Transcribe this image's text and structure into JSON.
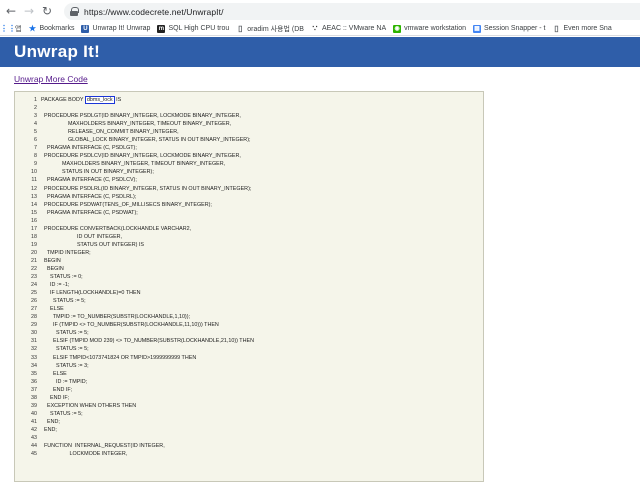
{
  "browser": {
    "back_icon": "back-arrow-icon",
    "forward_icon": "forward-arrow-icon",
    "reload_icon": "reload-icon",
    "url": "https://www.codecrete.net/UnwrapIt/"
  },
  "bookmarks": [
    {
      "label": "앱",
      "icon": "apps-grid-icon",
      "color": "#1a73e8"
    },
    {
      "label": "Bookmarks",
      "icon": "star-icon",
      "color": "#1a73e8"
    },
    {
      "label": "Unwrap It! Unwrap",
      "icon": "u-site-icon",
      "color": "#2f5ea9"
    },
    {
      "label": "SQL High CPU trou",
      "icon": "m-site-icon",
      "color": "#222222"
    },
    {
      "label": "oradim 사용법 (DB",
      "icon": "page-icon",
      "color": "#5f6368"
    },
    {
      "label": "AEAC :: VMware NA",
      "icon": "dots-icon",
      "color": "#333333"
    },
    {
      "label": "vmware workstation",
      "icon": "chat-icon",
      "color": "#2db400"
    },
    {
      "label": "Session Snapper - t",
      "icon": "calendar-icon",
      "color": "#4285f4"
    },
    {
      "label": "Even more Sna",
      "icon": "page-icon",
      "color": "#5f6368"
    }
  ],
  "page": {
    "title": "Unwrap It!",
    "more_link": "Unwrap More Code"
  },
  "code": {
    "highlight_token": "dbms_lock",
    "lines": [
      {
        "n": "1",
        "pre": "PACKAGE BODY ",
        "hl": "dbms_lock",
        "post": " IS"
      },
      {
        "n": "2",
        "text": ""
      },
      {
        "n": "3",
        "text": "  PROCEDURE PSDLGT(ID BINARY_INTEGER, LOCKMODE BINARY_INTEGER,"
      },
      {
        "n": "4",
        "text": "                  MAXHOLDERS BINARY_INTEGER, TIMEOUT BINARY_INTEGER,"
      },
      {
        "n": "5",
        "text": "                  RELEASE_ON_COMMIT BINARY_INTEGER,"
      },
      {
        "n": "6",
        "text": "                  GLOBAL_LOCK BINARY_INTEGER, STATUS IN OUT BINARY_INTEGER);"
      },
      {
        "n": "7",
        "text": "    PRAGMA INTERFACE (C, PSDLGT);"
      },
      {
        "n": "8",
        "text": "  PROCEDURE PSDLCV(ID BINARY_INTEGER, LOCKMODE BINARY_INTEGER,"
      },
      {
        "n": "9",
        "text": "              MAXHOLDERS BINARY_INTEGER, TIMEOUT BINARY_INTEGER,"
      },
      {
        "n": "10",
        "text": "              STATUS IN OUT BINARY_INTEGER);"
      },
      {
        "n": "11",
        "text": "    PRAGMA INTERFACE (C, PSDLCV);"
      },
      {
        "n": "12",
        "text": "  PROCEDURE PSDLRL(ID BINARY_INTEGER, STATUS IN OUT BINARY_INTEGER);"
      },
      {
        "n": "13",
        "text": "    PRAGMA INTERFACE (C, PSDLRL);"
      },
      {
        "n": "14",
        "text": "  PROCEDURE PSDWAT(TENS_OF_MILLISECS BINARY_INTEGER);"
      },
      {
        "n": "15",
        "text": "    PRAGMA INTERFACE (C, PSDWAT);"
      },
      {
        "n": "16",
        "text": ""
      },
      {
        "n": "17",
        "text": "  PROCEDURE CONVERTBACK(LOCKHANDLE VARCHAR2,"
      },
      {
        "n": "18",
        "text": "                        ID OUT INTEGER,"
      },
      {
        "n": "19",
        "text": "                        STATUS OUT INTEGER) IS"
      },
      {
        "n": "20",
        "text": "    TMPID INTEGER;"
      },
      {
        "n": "21",
        "text": "  BEGIN"
      },
      {
        "n": "22",
        "text": "    BEGIN"
      },
      {
        "n": "23",
        "text": "      STATUS := 0;"
      },
      {
        "n": "24",
        "text": "      ID := -1;"
      },
      {
        "n": "25",
        "text": "      IF LENGTH(LOCKHANDLE)=0 THEN"
      },
      {
        "n": "26",
        "text": "        STATUS := 5;"
      },
      {
        "n": "27",
        "text": "      ELSE"
      },
      {
        "n": "28",
        "text": "        TMPID := TO_NUMBER(SUBSTR(LOCKHANDLE,1,10));"
      },
      {
        "n": "29",
        "text": "        IF (TMPID <> TO_NUMBER(SUBSTR(LOCKHANDLE,11,10))) THEN"
      },
      {
        "n": "30",
        "text": "          STATUS := 5;"
      },
      {
        "n": "31",
        "text": "        ELSIF (TMPID MOD 239) <> TO_NUMBER(SUBSTR(LOCKHANDLE,21,10)) THEN"
      },
      {
        "n": "32",
        "text": "          STATUS := 5;"
      },
      {
        "n": "33",
        "text": "        ELSIF TMPID<1073741824 OR TMPID>1999999999 THEN"
      },
      {
        "n": "34",
        "text": "          STATUS := 3;"
      },
      {
        "n": "35",
        "text": "        ELSE"
      },
      {
        "n": "36",
        "text": "          ID := TMPID;"
      },
      {
        "n": "37",
        "text": "        END IF;"
      },
      {
        "n": "38",
        "text": "      END IF;"
      },
      {
        "n": "39",
        "text": "    EXCEPTION WHEN OTHERS THEN"
      },
      {
        "n": "40",
        "text": "      STATUS := 5;"
      },
      {
        "n": "41",
        "text": "    END;"
      },
      {
        "n": "42",
        "text": "  END;"
      },
      {
        "n": "43",
        "text": ""
      },
      {
        "n": "44",
        "text": "  FUNCTION  INTERNAL_REQUEST(ID INTEGER,"
      },
      {
        "n": "45",
        "text": "                   LOCKMODE INTEGER,"
      }
    ]
  }
}
